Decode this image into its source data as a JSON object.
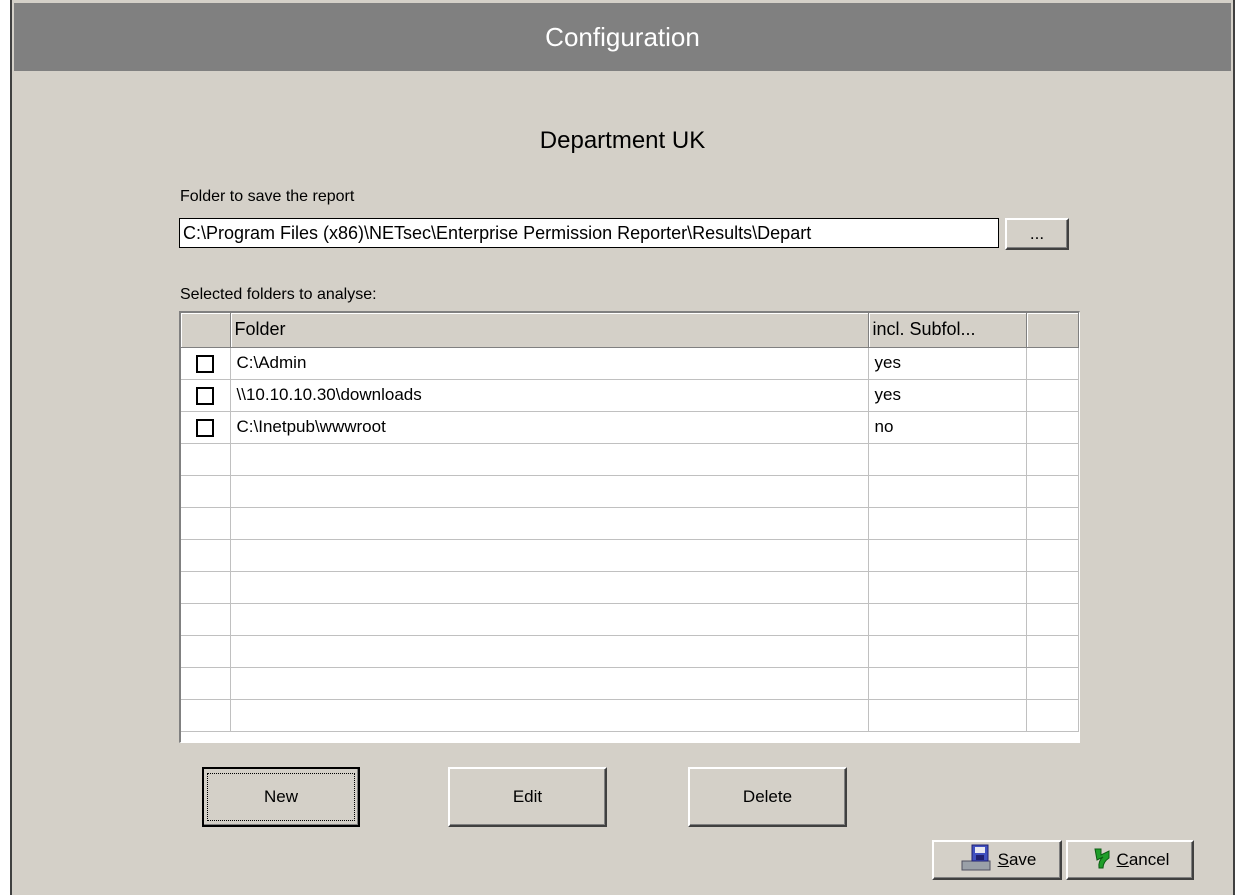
{
  "window": {
    "title": "Configuration"
  },
  "department": "Department UK",
  "report_folder": {
    "label": "Folder to save the report",
    "value": "C:\\Program Files (x86)\\NETsec\\Enterprise Permission Reporter\\Results\\Depart",
    "browse_label": "..."
  },
  "folders": {
    "label": "Selected folders to analyse:",
    "columns": [
      "",
      "Folder",
      "incl. Subfol...",
      ""
    ],
    "rows": [
      {
        "checked": false,
        "folder": "C:\\Admin",
        "subfolders": "yes"
      },
      {
        "checked": false,
        "folder": "\\\\10.10.10.30\\downloads",
        "subfolders": "yes"
      },
      {
        "checked": false,
        "folder": "C:\\Inetpub\\wwwroot",
        "subfolders": "no"
      }
    ]
  },
  "buttons": {
    "new": "New",
    "edit": "Edit",
    "delete": "Delete",
    "save_prefix": "S",
    "save_rest": "ave",
    "cancel_prefix": "C",
    "cancel_rest": "ancel"
  },
  "icons": {
    "save": "save-disk-icon",
    "cancel": "green-undo-arrow-icon"
  }
}
